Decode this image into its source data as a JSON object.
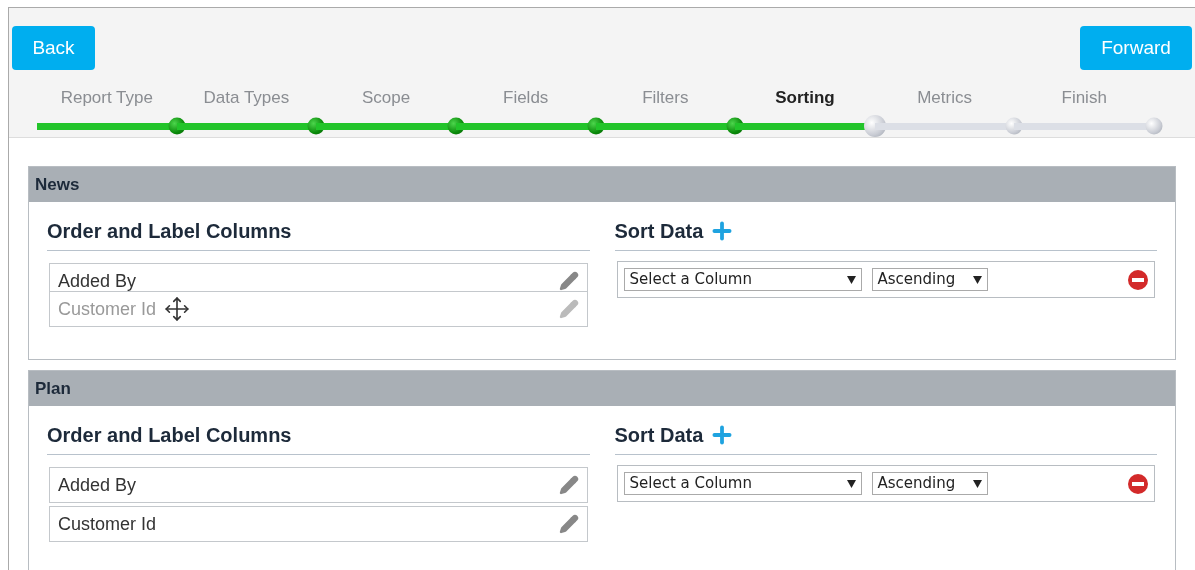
{
  "buttons": {
    "back": "Back",
    "forward": "Forward"
  },
  "steps": [
    {
      "label": "Report Type",
      "completed": true,
      "selected": false
    },
    {
      "label": "Data Types",
      "completed": true,
      "selected": false
    },
    {
      "label": "Scope",
      "completed": true,
      "selected": false
    },
    {
      "label": "Fields",
      "completed": true,
      "selected": false
    },
    {
      "label": "Filters",
      "completed": true,
      "selected": false
    },
    {
      "label": "Sorting",
      "completed": false,
      "selected": true
    },
    {
      "label": "Metrics",
      "completed": false,
      "selected": false
    },
    {
      "label": "Finish",
      "completed": false,
      "selected": false
    }
  ],
  "sections": [
    {
      "title": "News",
      "columns_heading": "Order and Label Columns",
      "columns": [
        {
          "label": "Added By",
          "dragging": false
        },
        {
          "label": "Customer Id",
          "dragging": true
        }
      ],
      "sort_heading": "Sort Data",
      "sort_rows": [
        {
          "column": "Select a Column",
          "direction": "Ascending"
        }
      ]
    },
    {
      "title": "Plan",
      "columns_heading": "Order and Label Columns",
      "columns": [
        {
          "label": "Added By",
          "dragging": false
        },
        {
          "label": "Customer Id",
          "dragging": false
        }
      ],
      "sort_heading": "Sort Data",
      "sort_rows": [
        {
          "column": "Select a Column",
          "direction": "Ascending"
        }
      ]
    }
  ]
}
